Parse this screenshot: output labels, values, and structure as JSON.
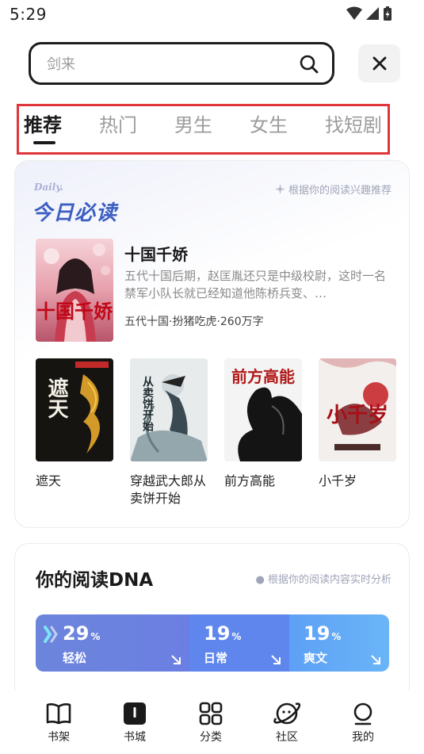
{
  "status_bar": {
    "time": "5:29"
  },
  "search": {
    "placeholder": "剑来"
  },
  "tabs": [
    {
      "label": "推荐",
      "active": true
    },
    {
      "label": "热门",
      "active": false
    },
    {
      "label": "男生",
      "active": false
    },
    {
      "label": "女生",
      "active": false
    },
    {
      "label": "找短剧",
      "active": false
    }
  ],
  "daily": {
    "label": "Daily.",
    "title": "今日必读",
    "tip": "根据你的阅读兴趣推荐",
    "featured": {
      "title": "十国千娇",
      "desc": "五代十国后期，赵匡胤还只是中级校尉，这时一名禁军小队长就已经知道他陈桥兵变、…",
      "meta": "五代十国·扮猪吃虎·260万字",
      "cover_text": "十国千娇"
    },
    "books": [
      {
        "title": "遮天",
        "cover_text": "遮天"
      },
      {
        "title": "穿越武大郎从卖饼开始",
        "cover_text": "从卖饼开始"
      },
      {
        "title": "前方高能",
        "cover_text": "前方高能"
      },
      {
        "title": "小千岁",
        "cover_text": "小千岁"
      }
    ]
  },
  "dna": {
    "title": "你的阅读DNA",
    "tip": "根据你的阅读内容实时分析",
    "segments": [
      {
        "percent": "29",
        "unit": "%",
        "label": "轻松",
        "share": 0.29
      },
      {
        "percent": "19",
        "unit": "%",
        "label": "日常",
        "share": 0.19
      },
      {
        "percent": "19",
        "unit": "%",
        "label": "爽文",
        "share": 0.19
      }
    ]
  },
  "nav": [
    {
      "label": "书架",
      "icon": "bookshelf-icon"
    },
    {
      "label": "书城",
      "icon": "bookstore-icon",
      "active": true
    },
    {
      "label": "分类",
      "icon": "category-icon"
    },
    {
      "label": "社区",
      "icon": "community-icon"
    },
    {
      "label": "我的",
      "icon": "profile-icon"
    }
  ]
}
